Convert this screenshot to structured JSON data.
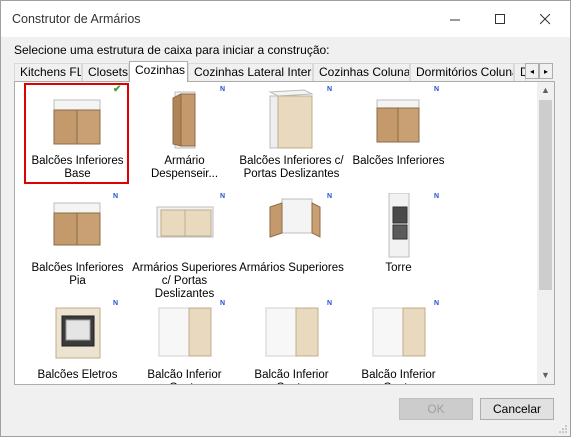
{
  "window": {
    "title": "Construtor de Armários",
    "minimize_icon": "minimize-icon",
    "maximize_icon": "maximize-icon",
    "close_icon": "close-icon"
  },
  "prompt": "Selecione uma estrutura de caixa para iniciar a construção:",
  "tabs": [
    {
      "label": "Kitchens FL",
      "active": false
    },
    {
      "label": "Closets",
      "active": false
    },
    {
      "label": "Cozinhas",
      "active": true
    },
    {
      "label": "Cozinhas Lateral Interna",
      "active": false
    },
    {
      "label": "Cozinhas Colunas",
      "active": false
    },
    {
      "label": "Dormitórios Colunas",
      "active": false
    },
    {
      "label": "D",
      "active": false
    }
  ],
  "tab_scroll": {
    "left": "◂",
    "right": "▸"
  },
  "items": [
    {
      "label": "Balcões Inferiores\nBase",
      "badge": "check",
      "selected": true
    },
    {
      "label": "Armário Despenseir...",
      "badge": "N",
      "selected": false
    },
    {
      "label": "Balcões Inferiores c/\nPortas Deslizantes",
      "badge": "N",
      "selected": false
    },
    {
      "label": "Balcões Inferiores",
      "badge": "N",
      "selected": false
    },
    {
      "label": "Balcões Inferiores Pia",
      "badge": "N",
      "selected": false
    },
    {
      "label": "Armários Superiores\nc/ Portas Deslizantes",
      "badge": "N",
      "selected": false
    },
    {
      "label": "Armários Superiores",
      "badge": "N",
      "selected": false
    },
    {
      "label": "Torre",
      "badge": "N",
      "selected": false
    },
    {
      "label": "Balcões Eletros",
      "badge": "N",
      "selected": false
    },
    {
      "label": "Balcão Inferior Canto\nReto Fixo c/ Rodapé",
      "badge": "N",
      "selected": false
    },
    {
      "label": "Balcão Inferior Canto\nReto Fixo c/ Rodapé",
      "badge": "N",
      "selected": false
    },
    {
      "label": "Balcão Inferior Canto\nReto Fixo",
      "badge": "N",
      "selected": false
    }
  ],
  "buttons": {
    "ok": "OK",
    "cancel": "Cancelar"
  },
  "colors": {
    "selection": "#e00000",
    "wood": "#c49a6c",
    "badge": "#1f4fd1",
    "check": "#3aa53a"
  }
}
